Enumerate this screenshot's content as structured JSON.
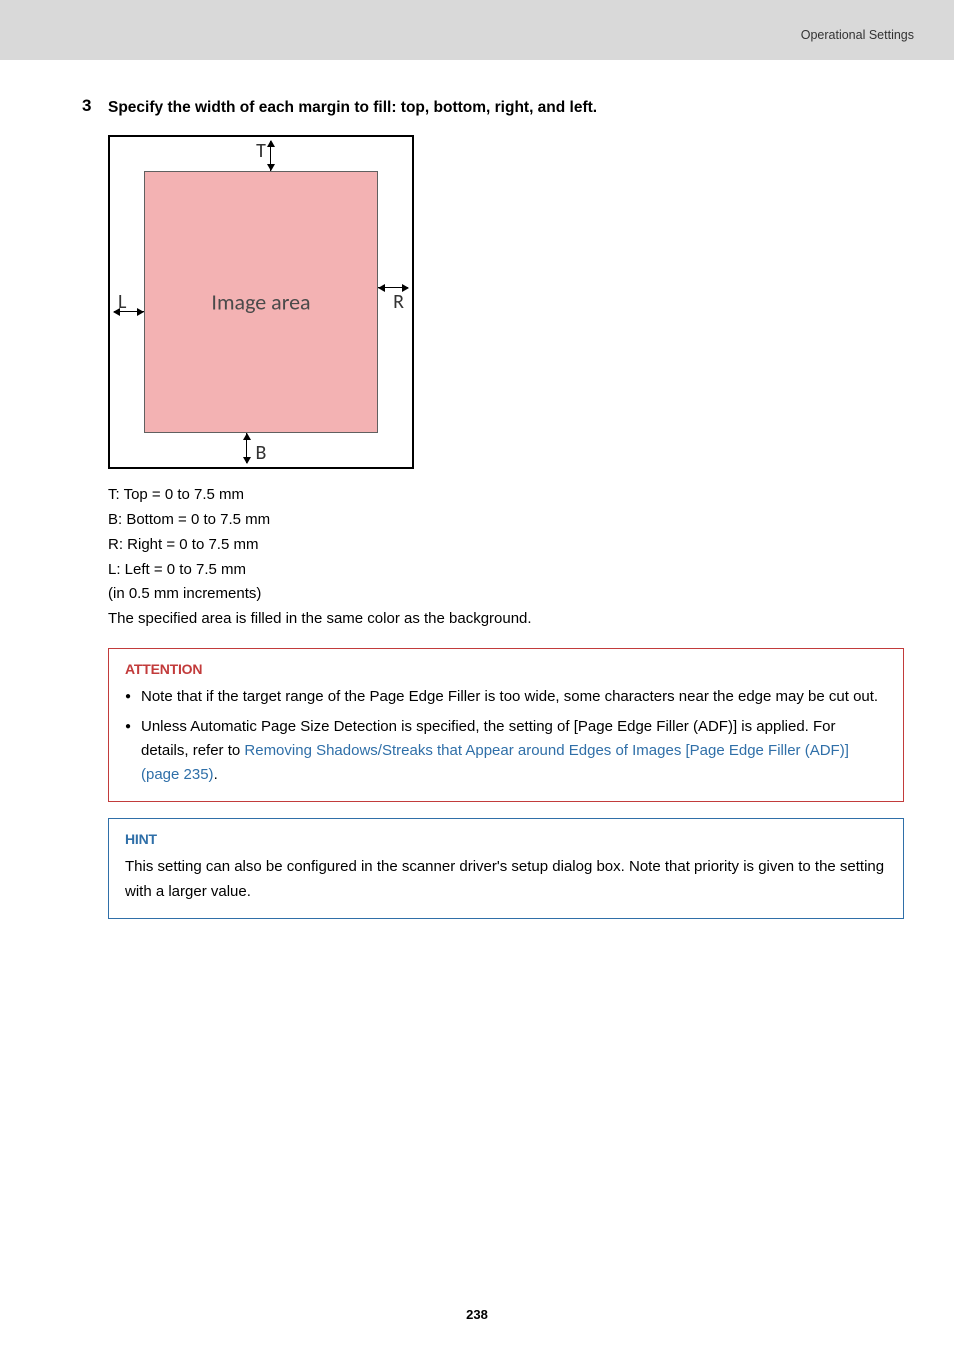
{
  "header": {
    "section": "Operational Settings"
  },
  "step": {
    "number": "3",
    "text": "Specify the width of each margin to fill: top, bottom, right, and left."
  },
  "diagram": {
    "center": "Image area",
    "T": "T",
    "B": "B",
    "L": "L",
    "R": "R"
  },
  "lines": {
    "t": "T: Top = 0 to 7.5 mm",
    "b": "B: Bottom = 0 to 7.5 mm",
    "r": "R: Right = 0 to 7.5 mm",
    "l": "L: Left = 0 to 7.5 mm",
    "inc": "(in 0.5 mm increments)",
    "note": "The specified area is filled in the same color as the background."
  },
  "attention": {
    "title": "ATTENTION",
    "b1": "Note that if the target range of the Page Edge Filler is too wide, some characters near the edge may be cut out.",
    "b2a": "Unless Automatic Page Size Detection is specified, the setting of [Page Edge Filler (ADF)] is applied. For details, refer to ",
    "b2link": "Removing Shadows/Streaks that Appear around Edges of Images [Page Edge Filler (ADF)] (page 235)",
    "b2b": "."
  },
  "hint": {
    "title": "HINT",
    "text": "This setting can also be configured in the scanner driver's setup dialog box. Note that priority is given to the setting with a larger value."
  },
  "page_number": "238"
}
